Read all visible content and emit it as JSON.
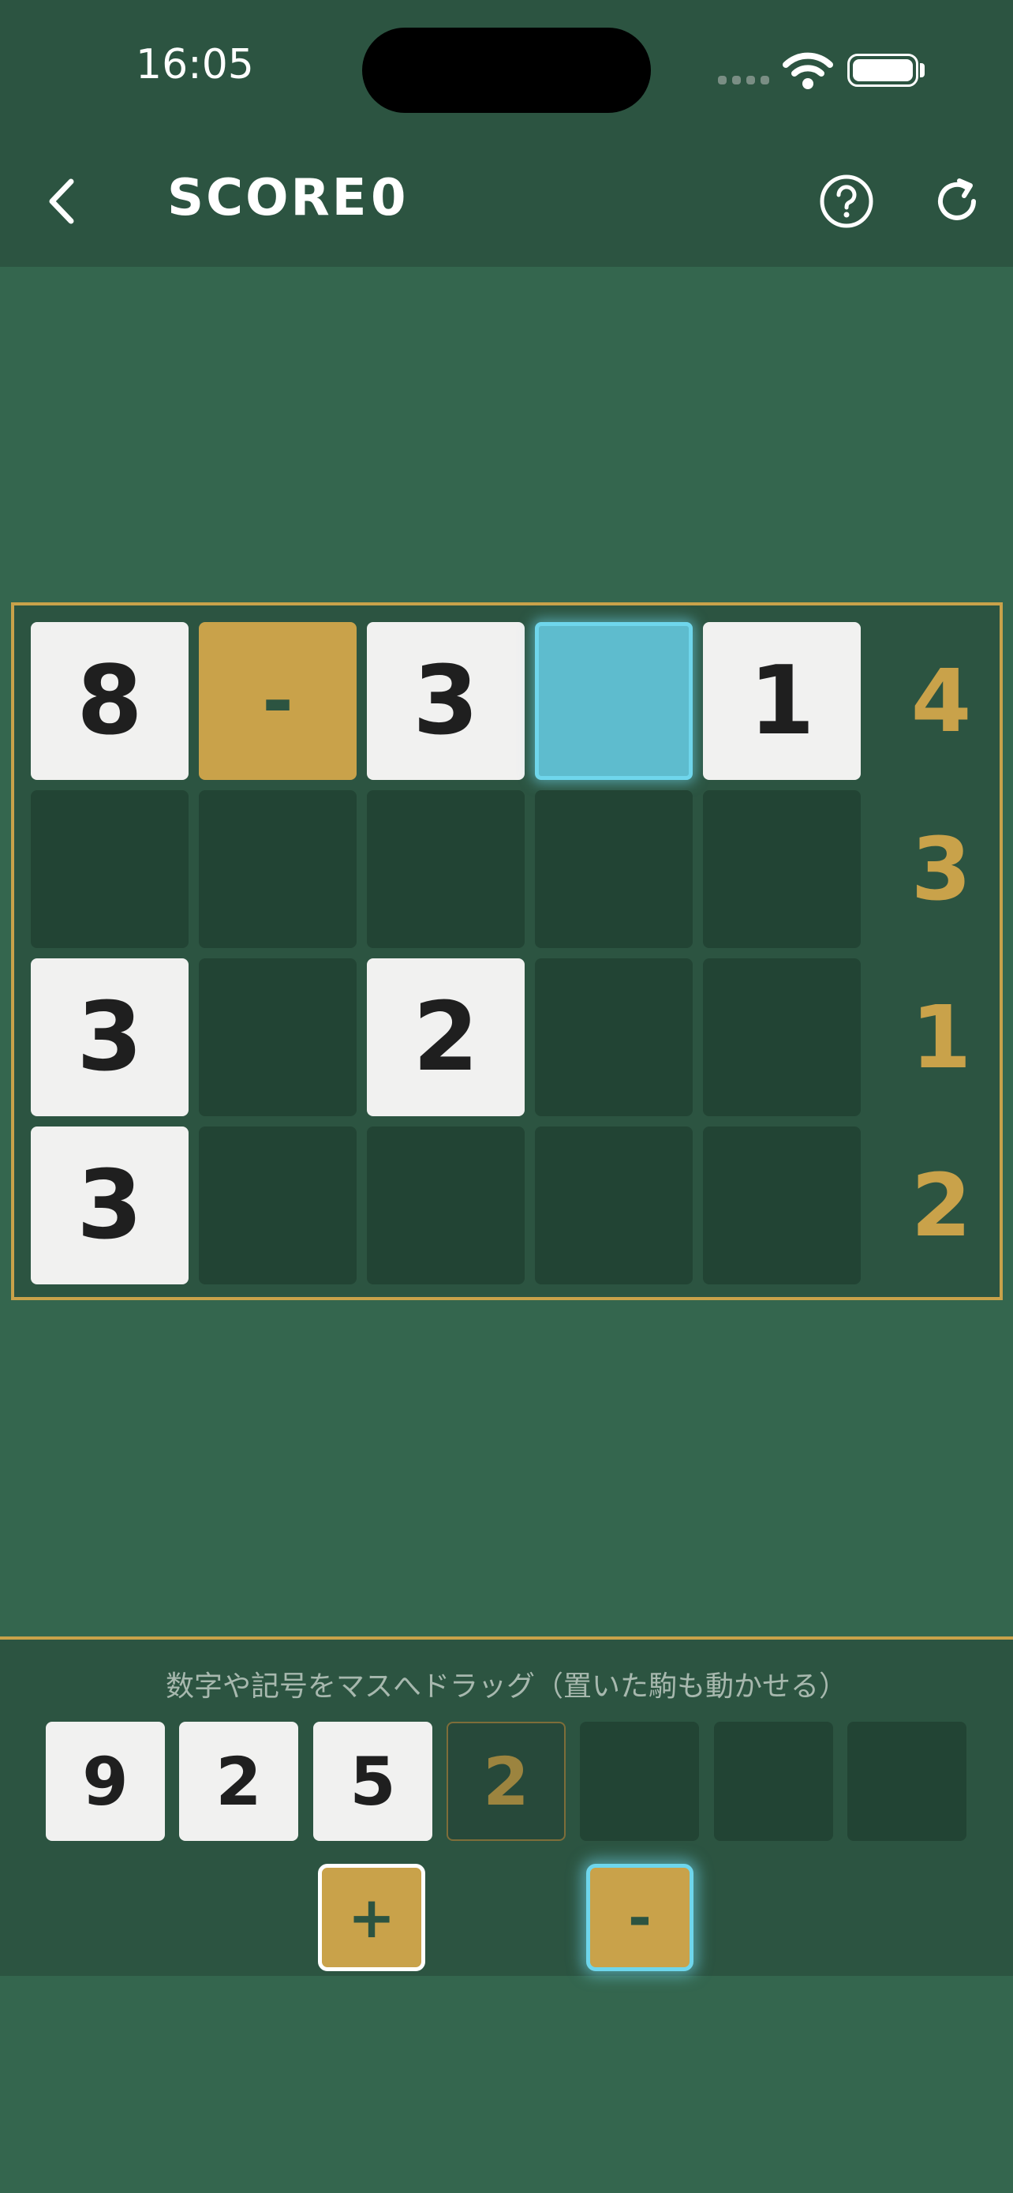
{
  "status_bar": {
    "time": "16:05"
  },
  "nav": {
    "score_label": "SCORE",
    "score_value": "0"
  },
  "board": {
    "rows": [
      {
        "cells": [
          "8",
          "-",
          "3",
          "",
          "1"
        ],
        "target": "4"
      },
      {
        "cells": [
          "",
          "",
          "",
          "",
          ""
        ],
        "target": "3"
      },
      {
        "cells": [
          "3",
          "",
          "2",
          "",
          ""
        ],
        "target": "1"
      },
      {
        "cells": [
          "3",
          "",
          "",
          "",
          ""
        ],
        "target": "2"
      }
    ]
  },
  "tray": {
    "hint": "数字や記号をマスへドラッグ（置いた駒も動かせる）",
    "tiles": [
      "9",
      "2",
      "5",
      "2",
      "",
      "",
      ""
    ],
    "operators": {
      "plus": "+",
      "minus": "-"
    }
  },
  "colors": {
    "accent_gold": "#c9a24a",
    "highlight_cyan": "#5ebcce",
    "background": "#34664e"
  }
}
